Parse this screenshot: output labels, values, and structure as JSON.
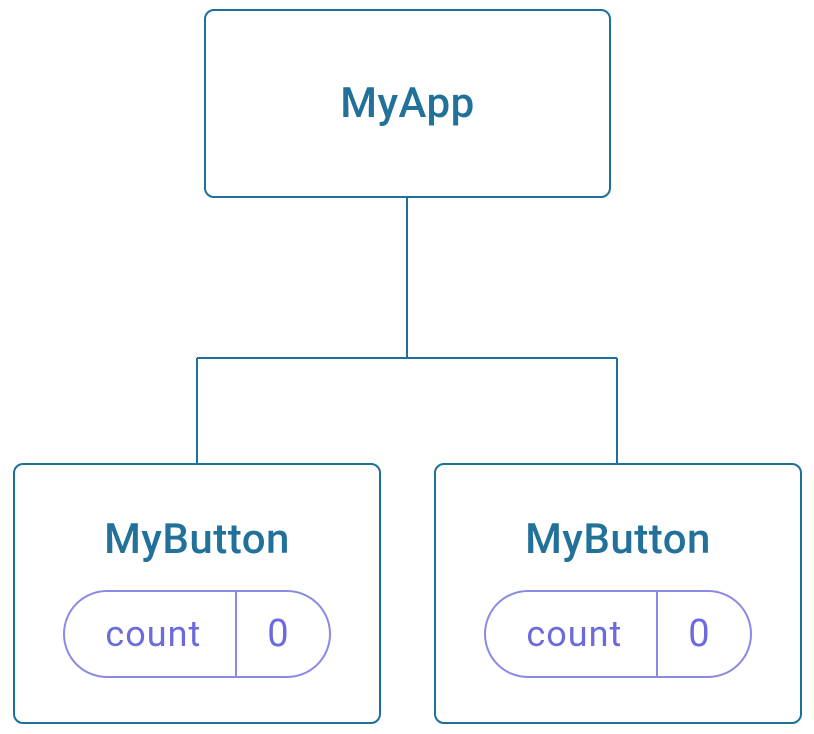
{
  "root": {
    "label": "MyApp"
  },
  "children": [
    {
      "label": "MyButton",
      "state_name": "count",
      "state_value": "0"
    },
    {
      "label": "MyButton",
      "state_name": "count",
      "state_value": "0"
    }
  ],
  "colors": {
    "node_border": "#1e6f9a",
    "node_text": "#21719b",
    "pill_border": "#8a8ae6",
    "pill_text": "#6b6bdc"
  }
}
